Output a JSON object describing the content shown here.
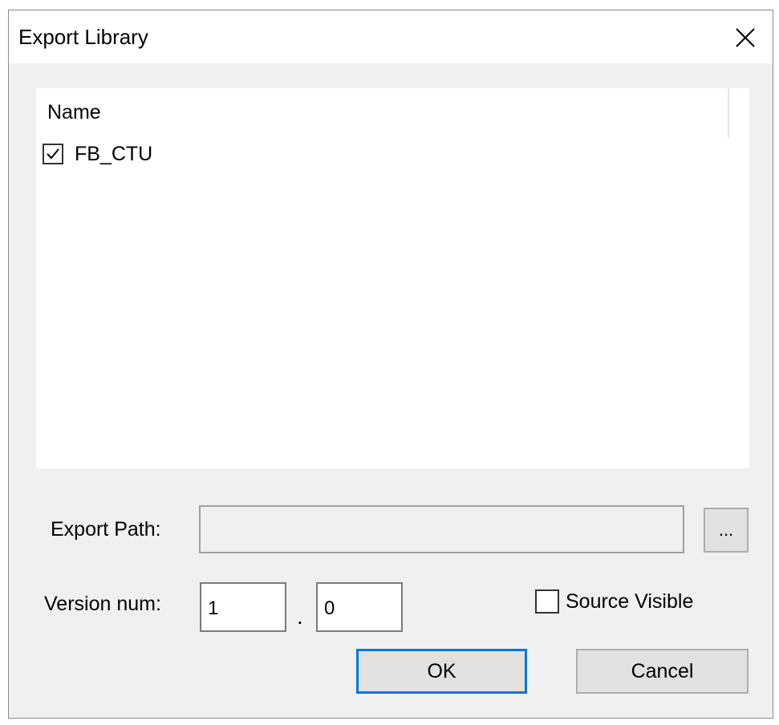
{
  "window": {
    "title": "Export Library",
    "close_icon": "close-icon"
  },
  "library_list": {
    "column_header": "Name",
    "items": [
      {
        "label": "FB_CTU",
        "checked": true
      }
    ]
  },
  "export_path": {
    "label": "Export Path:",
    "value": "",
    "browse_label": "..."
  },
  "version": {
    "label": "Version num:",
    "major": "1",
    "separator": ".",
    "minor": "0"
  },
  "source_visible": {
    "label": "Source Visible",
    "checked": false
  },
  "buttons": {
    "ok_label": "OK",
    "cancel_label": "Cancel"
  },
  "colors": {
    "dialog_bg": "#f0f0f0",
    "focus_border": "#0078d7",
    "button_bg": "#e1e1e1"
  }
}
